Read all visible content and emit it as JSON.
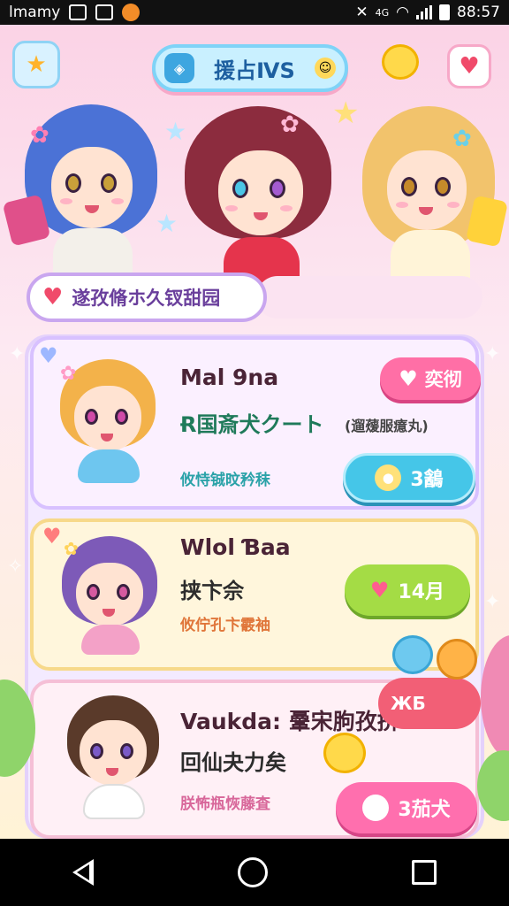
{
  "status_bar": {
    "carrier": "lmamy",
    "time": "88:57",
    "network": "4G"
  },
  "header": {
    "title": "援占ⅣS",
    "left_button_icon": "wand-star-icon",
    "right_button_icon": "mailbox-heart-icon"
  },
  "hero": {
    "subtitle": "遂孜脩ホ久钗甜园"
  },
  "cards": [
    {
      "name": "Mal 9na",
      "line": "Ɍ国斎犬クート",
      "tag_extra": "(遛蕿服癔丸)",
      "sub": "攸恃铖旼矜秣",
      "badge": "奕彻",
      "button": "3䳺"
    },
    {
      "name": "Wlol Ɓaa",
      "line": "挟卞佘",
      "sub": "攸佇孔卞霰袖",
      "button": "14月"
    },
    {
      "name": "Vaukda: 鞷宋朐孜挤",
      "line": "回仙夬力矣",
      "sub": "朕怖瓶恢藤査",
      "badge": "ЖБ",
      "button": "3茄犬"
    }
  ],
  "colors": {
    "accent_pink": "#ff6fa6",
    "accent_teal": "#45c6e8",
    "accent_green": "#a4dc45",
    "panel_lilac": "#f3eaff"
  },
  "nav": {
    "back_icon": "back-triangle-icon",
    "home_icon": "home-circle-icon",
    "recent_icon": "recent-square-icon"
  }
}
